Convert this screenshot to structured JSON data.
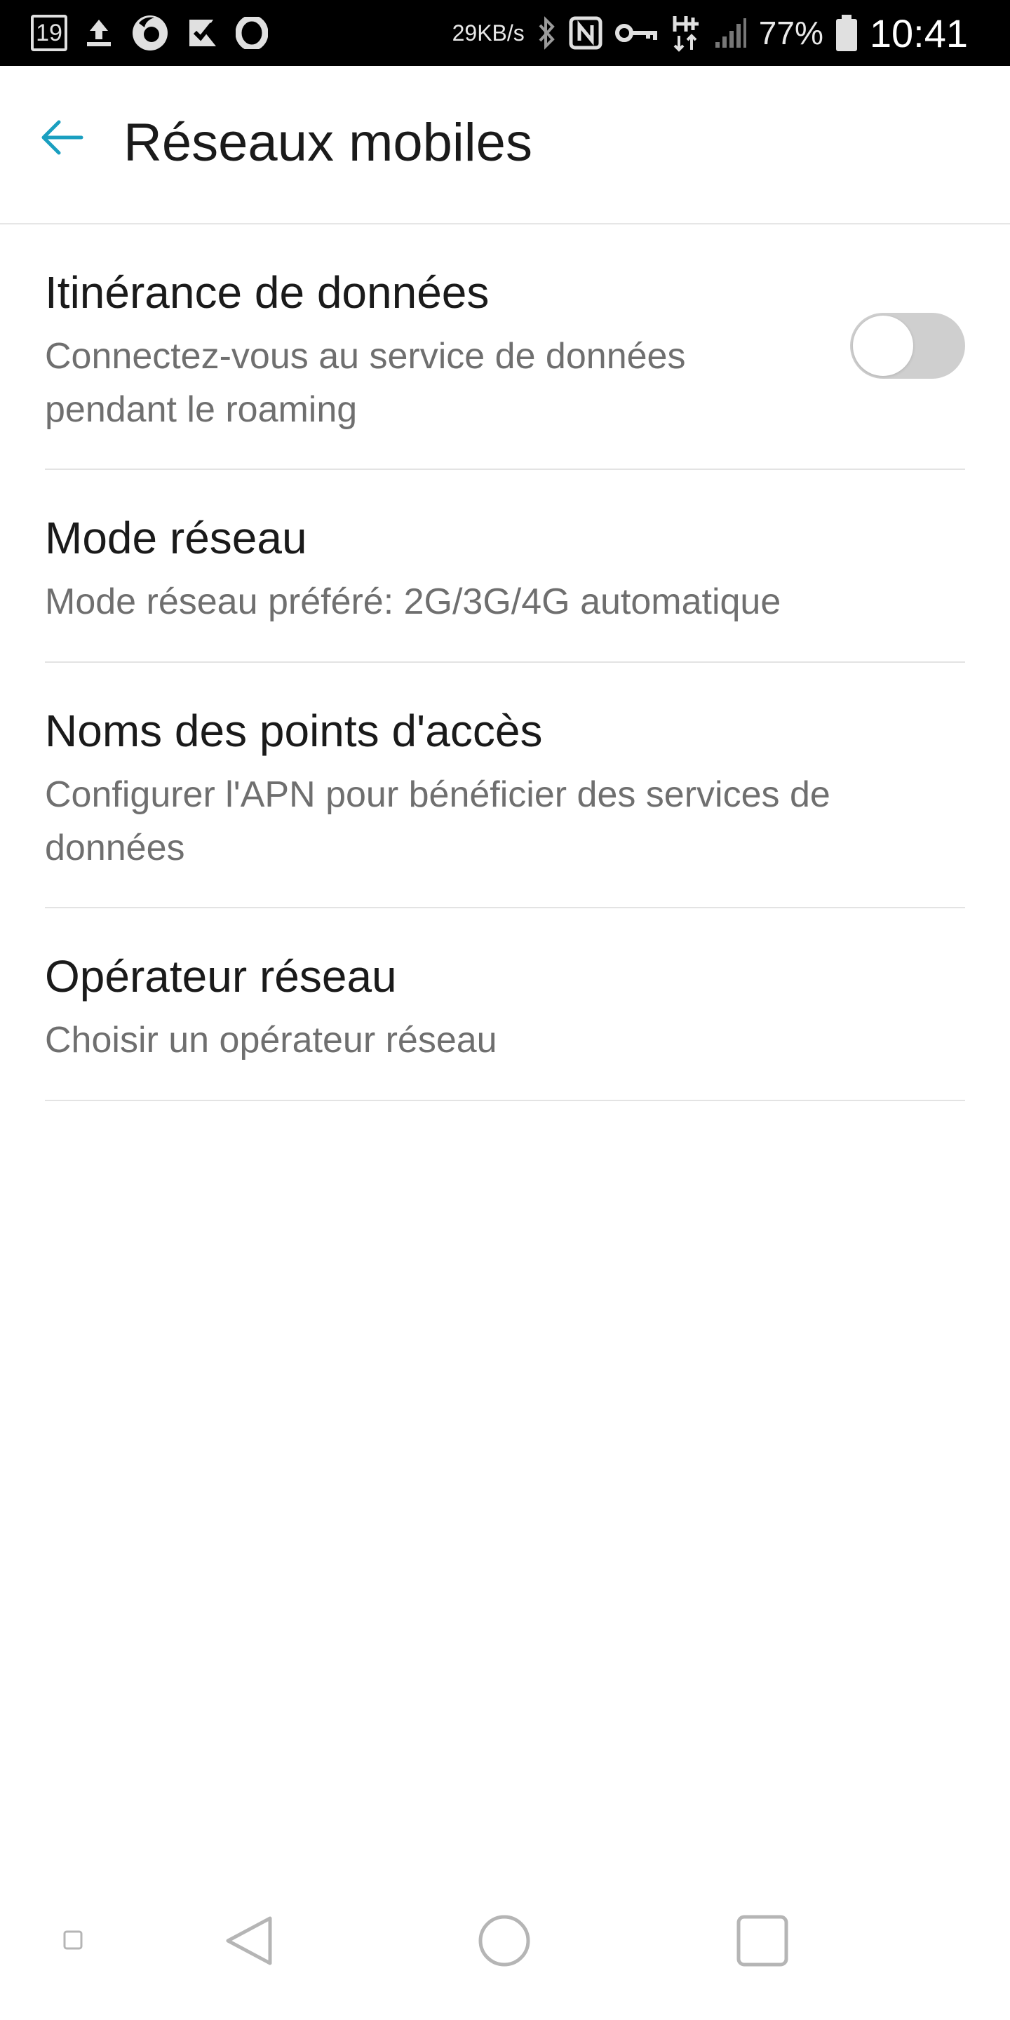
{
  "status_bar": {
    "calendar_day": "19",
    "network_speed": "29KB/s",
    "battery_percent": "77%",
    "time": "10:41",
    "icons": [
      "calendar-icon",
      "upload-icon",
      "firefox-icon",
      "task-check-icon",
      "opera-icon",
      "location-icon",
      "bluetooth-icon",
      "nfc-icon",
      "vpn-key-icon",
      "data-hplus-icon",
      "signal-icon",
      "battery-icon"
    ]
  },
  "app_bar": {
    "title": "Réseaux mobiles",
    "back_icon": "back-arrow-icon",
    "accent_color": "#1a9fc0"
  },
  "settings": [
    {
      "title": "Itinérance de données",
      "subtitle": "Connectez-vous au service de données pendant le roaming",
      "toggle": {
        "checked": false
      }
    },
    {
      "title": "Mode réseau",
      "subtitle": "Mode réseau préféré: 2G/3G/4G automatique"
    },
    {
      "title": "Noms des points d'accès",
      "subtitle": "Configurer l'APN pour bénéficier des services de données"
    },
    {
      "title": "Opérateur réseau",
      "subtitle": "Choisir un opérateur réseau"
    }
  ],
  "nav_bar": {
    "buttons": [
      "pin-icon",
      "back-icon",
      "home-icon",
      "recents-icon"
    ]
  }
}
